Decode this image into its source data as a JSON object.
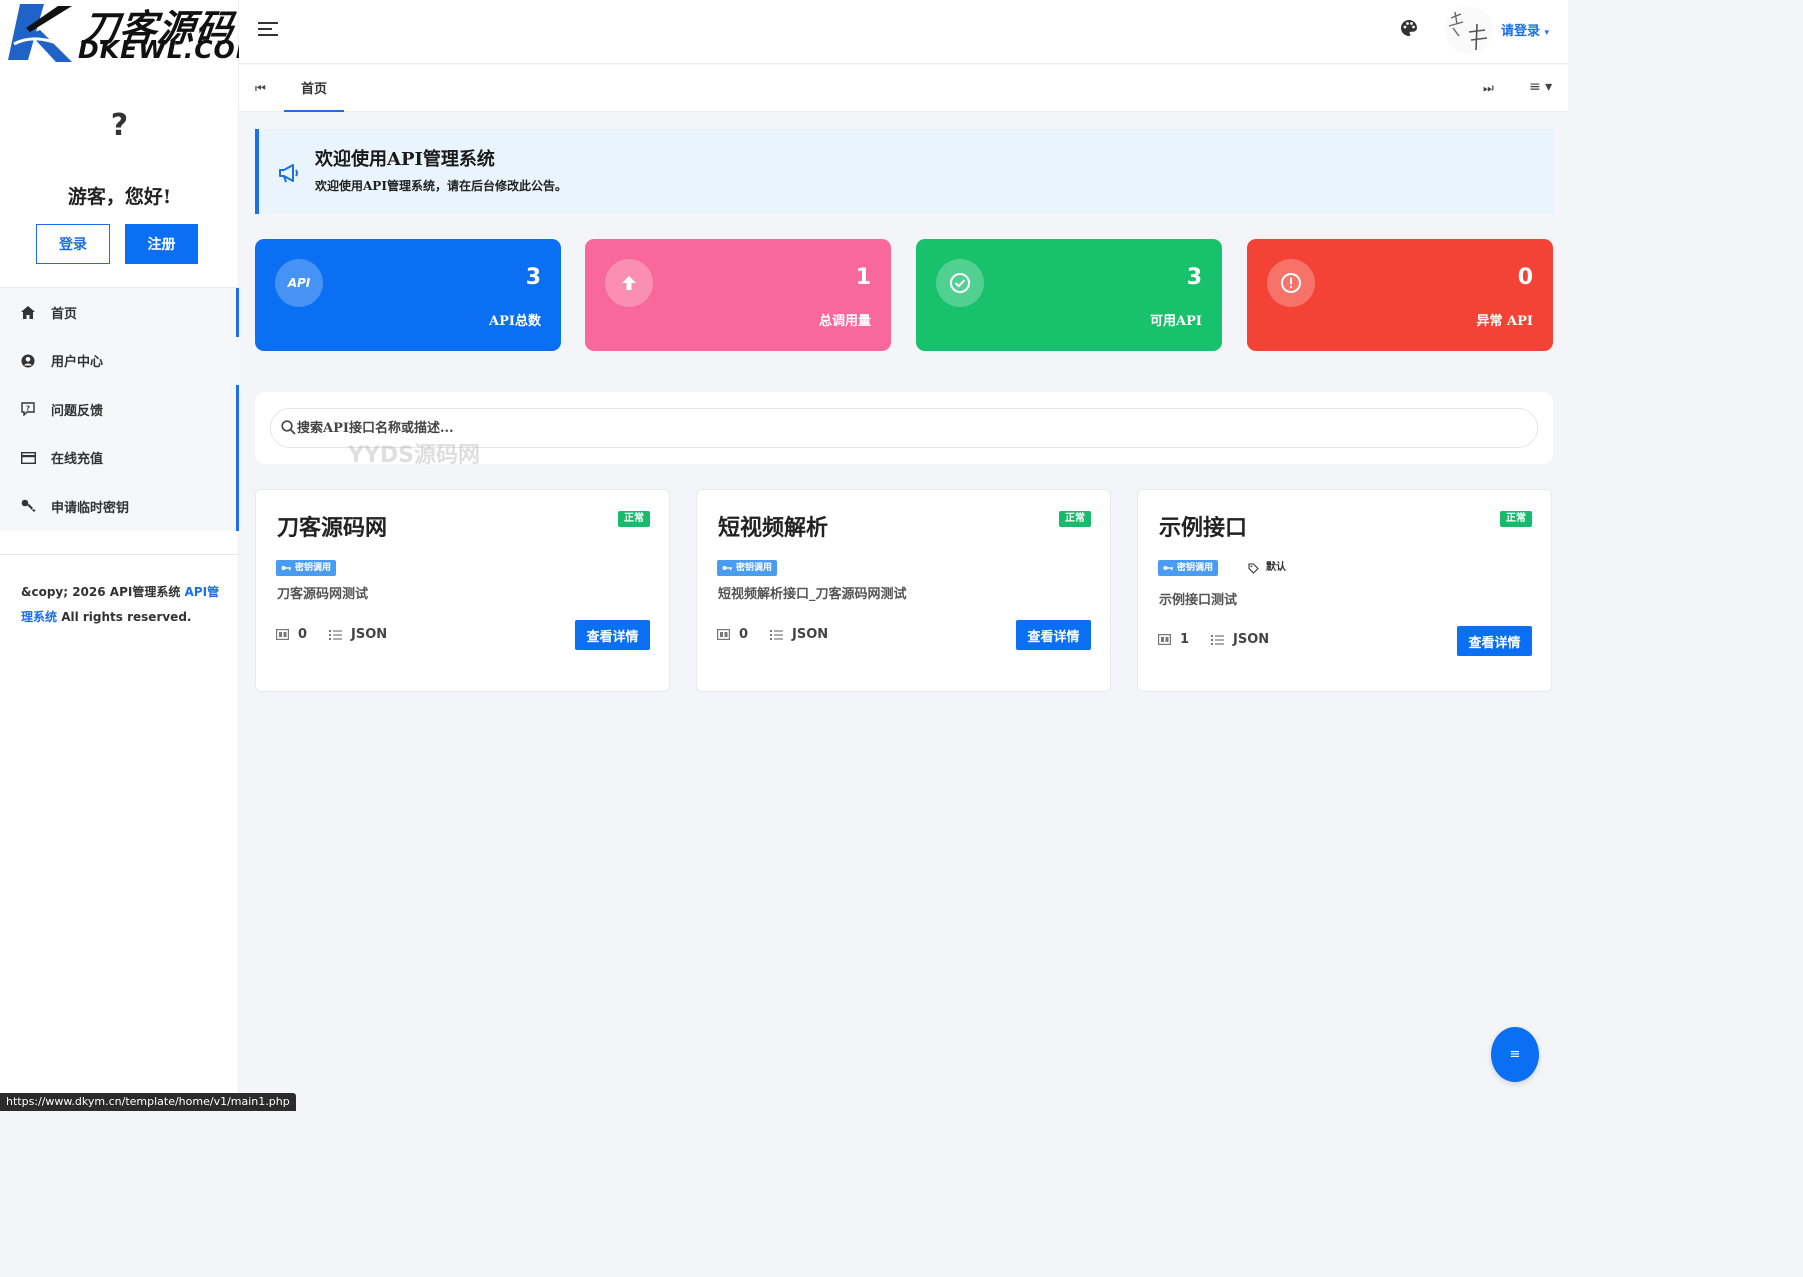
{
  "brand": {
    "logo_cn": "刀客源码",
    "logo_en": "DKEWL.COM"
  },
  "sidebar": {
    "avatar_glyph": "?",
    "greeting": "游客，您好!",
    "login_label": "登录",
    "register_label": "注册",
    "menu": [
      {
        "label": "首页",
        "icon": "home-icon"
      },
      {
        "label": "用户中心",
        "icon": "user-circle-icon"
      },
      {
        "label": "问题反馈",
        "icon": "feedback-icon"
      },
      {
        "label": "在线充值",
        "icon": "credit-card-icon"
      },
      {
        "label": "申请临时密钥",
        "icon": "key-icon"
      }
    ],
    "copyright_prefix": "&copy; 2026 API管理系统 ",
    "copyright_link": "API管理系统",
    "copyright_suffix": " All rights reserved."
  },
  "header": {
    "user_label": "请登录"
  },
  "tabs": {
    "home": "首页",
    "prev_glyph": "⏮",
    "next_glyph": "⏭",
    "menu_glyph": "≡ ▾"
  },
  "notice": {
    "title": "欢迎使用API管理系统",
    "text": "欢迎使用API管理系统，请在后台修改此公告。"
  },
  "stats": [
    {
      "value": "3",
      "label": "API总数",
      "icon": "api-icon",
      "icon_text": "API",
      "color": "#0a6ff2"
    },
    {
      "value": "1",
      "label": "总调用量",
      "icon": "arrow-up-icon",
      "color": "#f8689a"
    },
    {
      "value": "3",
      "label": "可用API",
      "icon": "check-circle-icon",
      "color": "#18c16c"
    },
    {
      "value": "0",
      "label": "异常 API",
      "icon": "alert-circle-icon",
      "color": "#f44336"
    }
  ],
  "search": {
    "placeholder": "搜索API接口名称或描述..."
  },
  "watermark": "YYDS源码网",
  "apis": [
    {
      "name": "刀客源码网",
      "status": "正常",
      "tag": "密钥调用",
      "tag2": "",
      "desc": "刀客源码网测试",
      "calls": "0",
      "format": "JSON",
      "button": "查看详情"
    },
    {
      "name": "短视频解析",
      "status": "正常",
      "tag": "密钥调用",
      "tag2": "",
      "desc": "短视频解析接口_刀客源码网测试",
      "calls": "0",
      "format": "JSON",
      "button": "查看详情"
    },
    {
      "name": "示例接口",
      "status": "正常",
      "tag": "密钥调用",
      "tag2": "默认",
      "desc": "示例接口测试",
      "calls": "1",
      "format": "JSON",
      "button": "查看详情"
    }
  ],
  "status_bar_url": "https://www.dkym.cn/template/home/v1/main1.php",
  "fab_glyph": "≡",
  "colors": {
    "accent": "#0a6ff2",
    "success": "#18bb6c",
    "notice_bg": "#eaf4fd"
  }
}
